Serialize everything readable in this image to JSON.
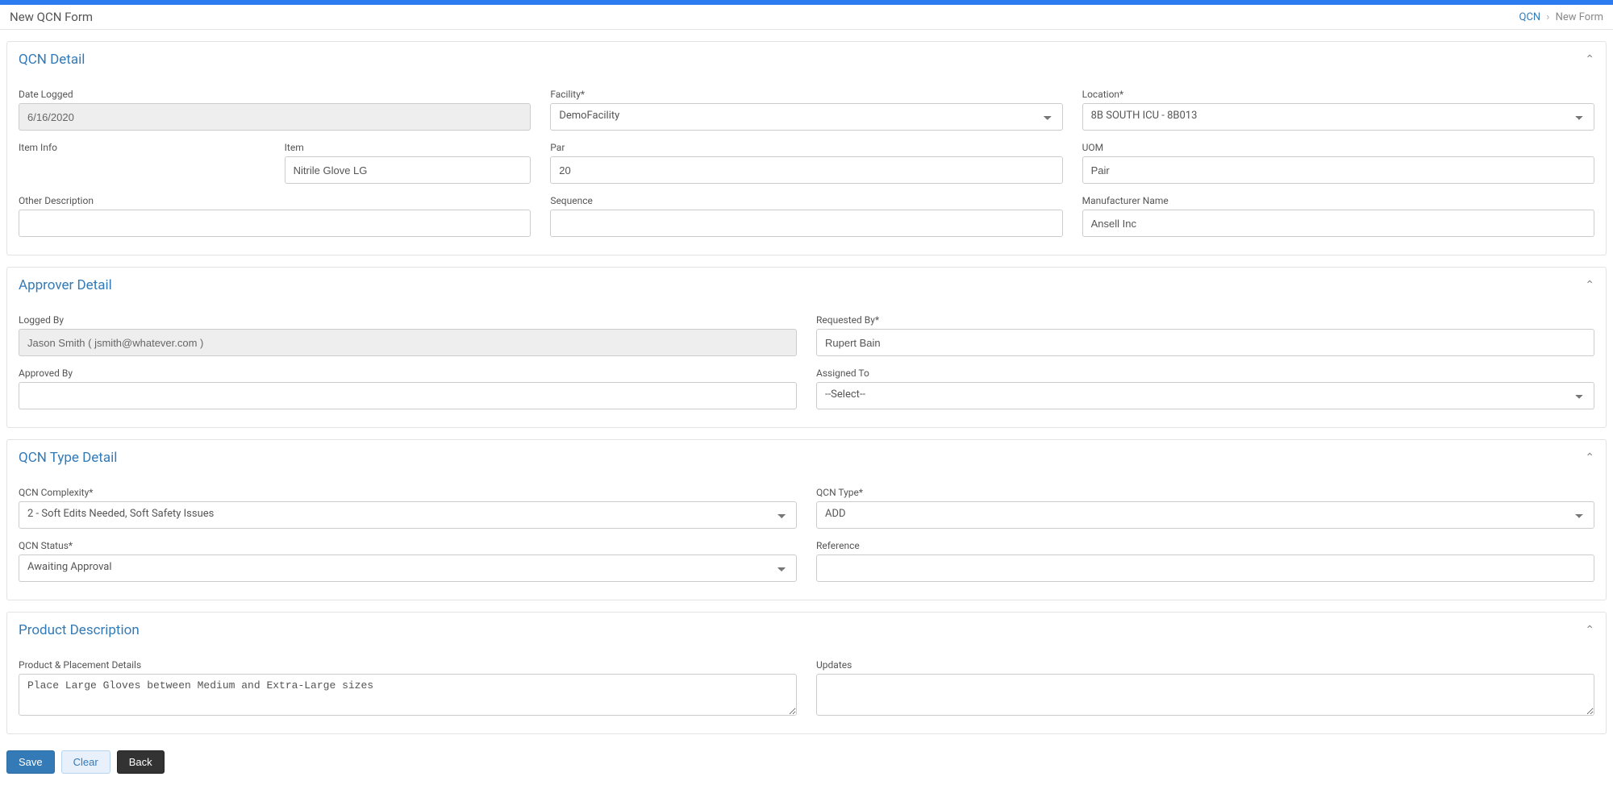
{
  "header": {
    "title": "New QCN Form",
    "breadcrumb": {
      "root": "QCN",
      "current": "New Form"
    }
  },
  "sections": {
    "qcnDetail": {
      "title": "QCN Detail"
    },
    "approverDetail": {
      "title": "Approver Detail"
    },
    "qcnTypeDetail": {
      "title": "QCN Type Detail"
    },
    "productDescription": {
      "title": "Product Description"
    }
  },
  "qcnDetail": {
    "dateLogged": {
      "label": "Date Logged",
      "value": "6/16/2020"
    },
    "facility": {
      "label": "Facility*",
      "value": "DemoFacility"
    },
    "location": {
      "label": "Location*",
      "value": "8B SOUTH ICU - 8B013"
    },
    "itemInfo": {
      "label": "Item Info"
    },
    "item": {
      "label": "Item",
      "value": "Nitrile Glove LG"
    },
    "par": {
      "label": "Par",
      "value": "20"
    },
    "uom": {
      "label": "UOM",
      "value": "Pair"
    },
    "otherDescription": {
      "label": "Other Description",
      "value": ""
    },
    "sequence": {
      "label": "Sequence",
      "value": ""
    },
    "manufacturerName": {
      "label": "Manufacturer Name",
      "value": "Ansell Inc"
    }
  },
  "approverDetail": {
    "loggedBy": {
      "label": "Logged By",
      "value": "Jason Smith ( jsmith@whatever.com )"
    },
    "requestedBy": {
      "label": "Requested By*",
      "value": "Rupert Bain"
    },
    "approvedBy": {
      "label": "Approved By",
      "value": ""
    },
    "assignedTo": {
      "label": "Assigned To",
      "value": "--Select--"
    }
  },
  "qcnTypeDetail": {
    "complexity": {
      "label": "QCN Complexity*",
      "value": "2 - Soft Edits Needed, Soft Safety Issues"
    },
    "qcnType": {
      "label": "QCN Type*",
      "value": "ADD"
    },
    "status": {
      "label": "QCN Status*",
      "value": "Awaiting Approval"
    },
    "reference": {
      "label": "Reference",
      "value": ""
    }
  },
  "productDescription": {
    "placementDetails": {
      "label": "Product & Placement Details",
      "value": "Place Large Gloves between Medium and Extra-Large sizes"
    },
    "updates": {
      "label": "Updates",
      "value": ""
    }
  },
  "actions": {
    "save": "Save",
    "clear": "Clear",
    "back": "Back"
  }
}
